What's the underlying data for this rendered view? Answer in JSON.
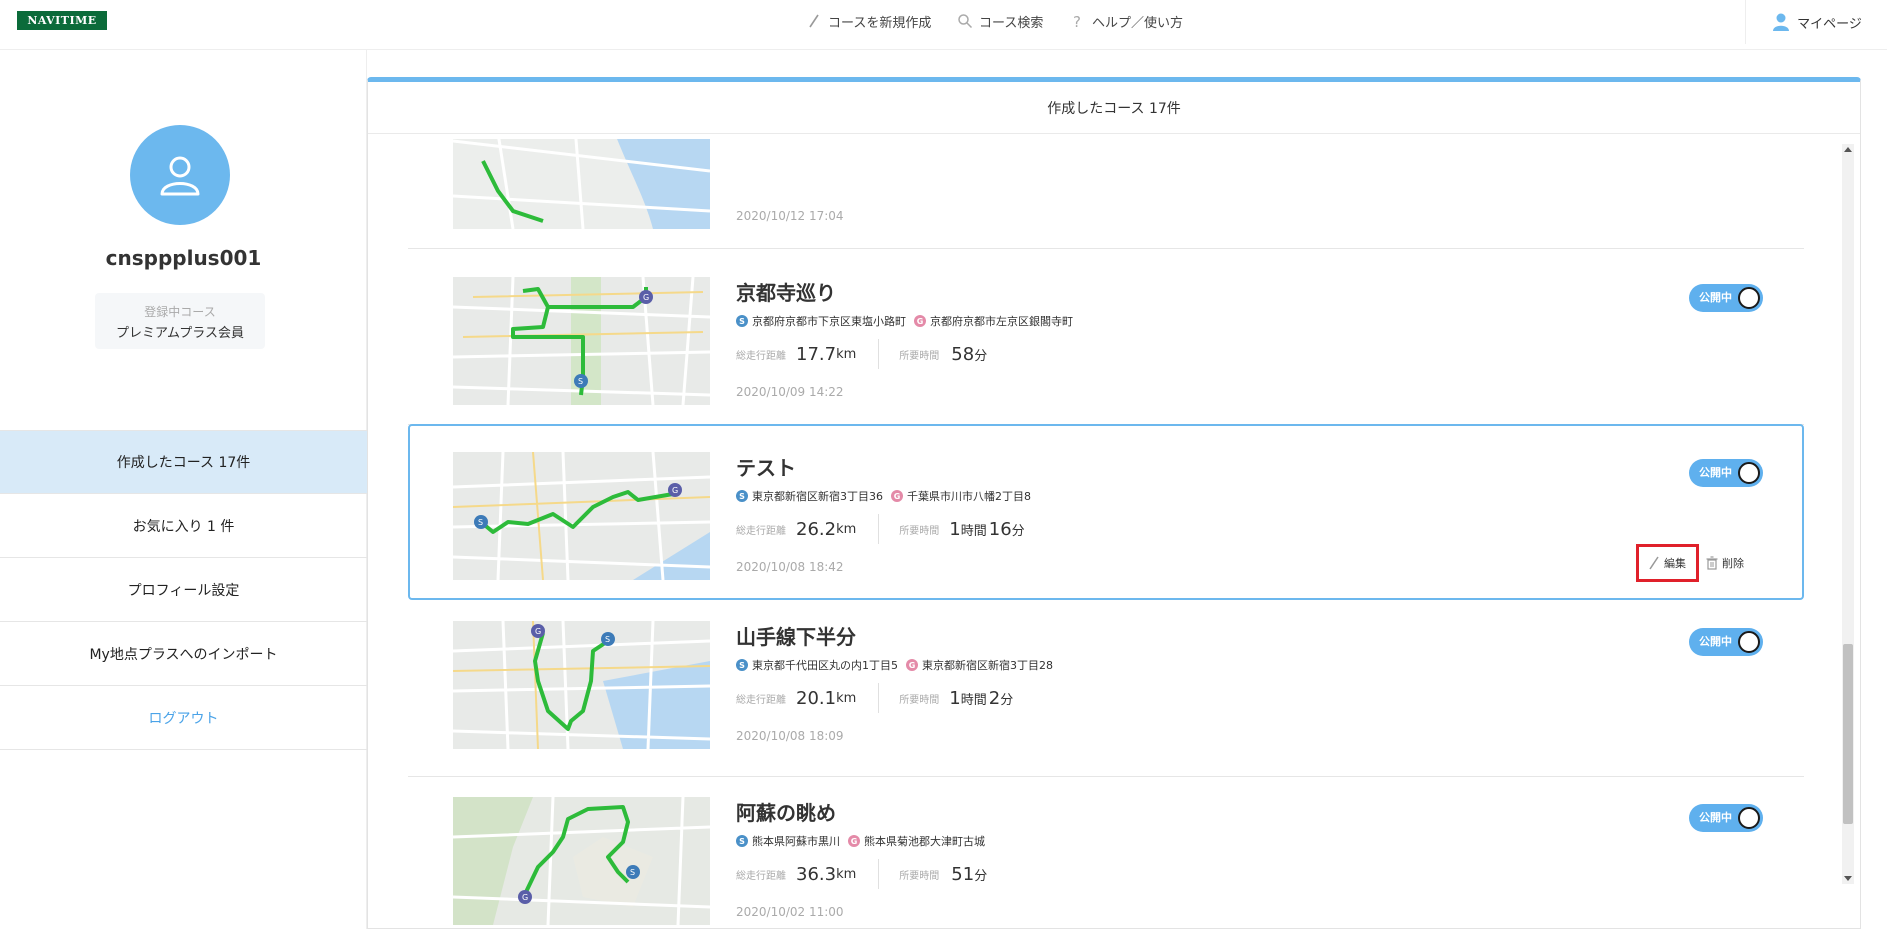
{
  "header": {
    "logo": "NAVITIME",
    "nav": [
      {
        "label": "コースを新規作成",
        "icon": "pencil-icon"
      },
      {
        "label": "コース検索",
        "icon": "search-icon"
      },
      {
        "label": "ヘルプ／使い方",
        "icon": "question-icon"
      }
    ],
    "mypage": "マイページ"
  },
  "sidebar": {
    "username": "cnsppplus001",
    "plan_label": "登録中コース",
    "plan_value": "プレミアムプラス会員",
    "menu": [
      {
        "label": "作成したコース 17件",
        "active": true
      },
      {
        "label": "お気に入り 1 件",
        "active": false
      },
      {
        "label": "プロフィール設定",
        "active": false
      },
      {
        "label": "My地点プラスへのインポート",
        "active": false
      },
      {
        "label": "ログアウト",
        "active": false
      }
    ]
  },
  "panel": {
    "title": "作成したコース 17件"
  },
  "labels": {
    "distance": "総走行距離",
    "time": "所要時間",
    "edit": "編集",
    "delete": "削除",
    "public": "公開中",
    "start_badge": "S",
    "goal_badge": "G"
  },
  "courses": [
    {
      "date": "2020/10/12 17:04"
    },
    {
      "title": "京都寺巡り",
      "start": "京都府京都市下京区東塩小路町",
      "goal": "京都府京都市左京区銀閣寺町",
      "distance": "17.7",
      "distance_unit": "km",
      "time_h": "",
      "time_h_unit": "",
      "time_m": "58",
      "time_m_unit": "分",
      "date": "2020/10/09 14:22"
    },
    {
      "title": "テスト",
      "start": "東京都新宿区新宿3丁目36",
      "goal": "千葉県市川市八幡2丁目8",
      "distance": "26.2",
      "distance_unit": "km",
      "time_h": "1",
      "time_h_unit": "時間",
      "time_m": "16",
      "time_m_unit": "分",
      "date": "2020/10/08 18:42"
    },
    {
      "title": "山手線下半分",
      "start": "東京都千代田区丸の内1丁目5",
      "goal": "東京都新宿区新宿3丁目28",
      "distance": "20.1",
      "distance_unit": "km",
      "time_h": "1",
      "time_h_unit": "時間",
      "time_m": "2",
      "time_m_unit": "分",
      "date": "2020/10/08 18:09"
    },
    {
      "title": "阿蘇の眺め",
      "start": "熊本県阿蘇市黒川",
      "goal": "熊本県菊池郡大津町古城",
      "distance": "36.3",
      "distance_unit": "km",
      "time_h": "",
      "time_h_unit": "",
      "time_m": "51",
      "time_m_unit": "分",
      "date": "2020/10/02 11:00"
    }
  ],
  "colors": {
    "accent": "#6cb8ee",
    "logo_bg": "#0b6b3a",
    "route": "#2dbb3a",
    "highlight": "#e0202a"
  }
}
